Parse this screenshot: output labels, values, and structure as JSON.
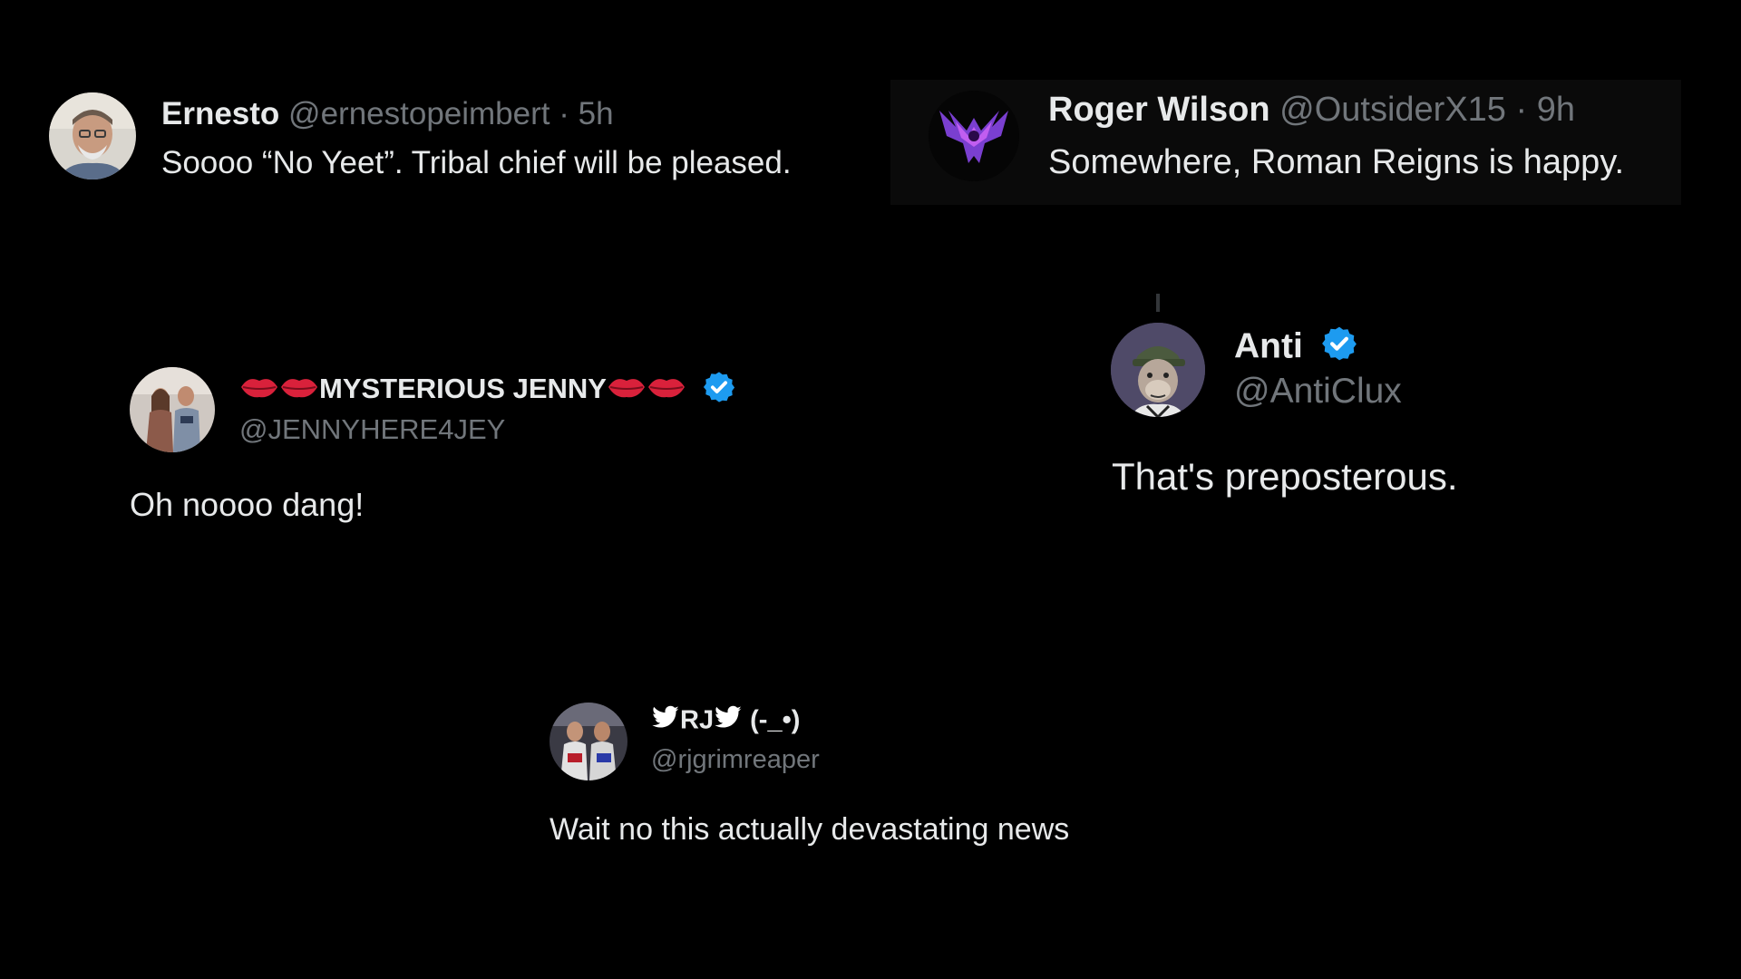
{
  "colors": {
    "background": "#000000",
    "text_primary": "#e7e9ea",
    "text_secondary": "#71767b",
    "verified_blue": "#1d9bf0"
  },
  "tweets": [
    {
      "display_name": "Ernesto",
      "handle": "@ernestopeimbert",
      "separator": "·",
      "time": "5h",
      "text": "Soooo “No Yeet”.  Tribal chief will be pleased.",
      "avatar_icon": "avatar-man-photo"
    },
    {
      "display_name": "Roger Wilson",
      "handle": "@OutsiderX15",
      "separator": "·",
      "time": "9h",
      "text": "Somewhere, Roman Reigns is happy.",
      "avatar_icon": "avatar-purple-emblem"
    },
    {
      "display_name": "MYSTERIOUS JENNY",
      "name_emoji": "lips-icon",
      "verified": true,
      "handle": "@JENNYHERE4JEY",
      "text": "Oh noooo dang!",
      "avatar_icon": "avatar-couple-photo"
    },
    {
      "display_name": "Anti",
      "verified": true,
      "handle": "@AntiClux",
      "text": "That's preposterous.",
      "avatar_icon": "avatar-ape-illustration"
    },
    {
      "display_name": "RJ",
      "name_suffix": "(-_•)",
      "name_emoji": "bird-icon",
      "handle": "@rjgrimreaper",
      "text": "Wait no this actually devastating news",
      "avatar_icon": "avatar-wrestlers-photo"
    }
  ]
}
